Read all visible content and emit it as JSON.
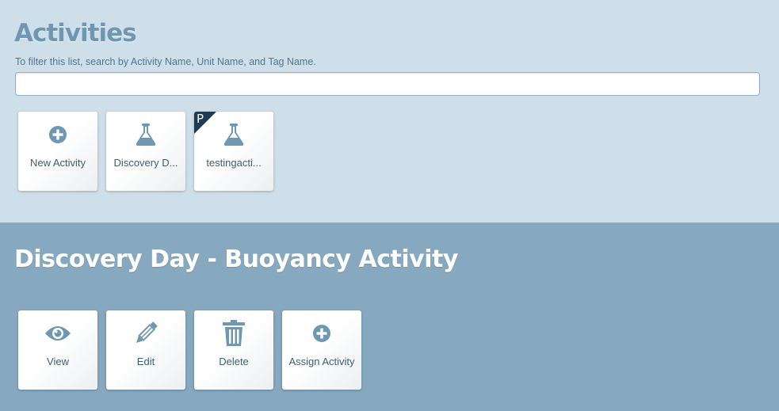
{
  "activities": {
    "title": "Activities",
    "filter_hint": "To filter this list, search by Activity Name, Unit Name, and Tag Name.",
    "search_value": "",
    "search_placeholder": "",
    "tiles": [
      {
        "label": "New Activity",
        "icon": "plus-circle-icon"
      },
      {
        "label": "Discovery D...",
        "icon": "flask-icon"
      },
      {
        "label": "testingacti...",
        "icon": "flask-icon",
        "badge": "P"
      }
    ]
  },
  "detail": {
    "title": "Discovery Day - Buoyancy Activity",
    "actions": [
      {
        "label": "View",
        "icon": "eye-icon"
      },
      {
        "label": "Edit",
        "icon": "pencil-icon"
      },
      {
        "label": "Delete",
        "icon": "trash-icon"
      },
      {
        "label": "Assign Activity",
        "icon": "plus-circle-icon"
      }
    ]
  },
  "colors": {
    "top_background": "#cfdfe9",
    "bottom_background": "#87a9c0",
    "icon_color": "#6f97b1",
    "badge_color": "#1d3b52"
  }
}
